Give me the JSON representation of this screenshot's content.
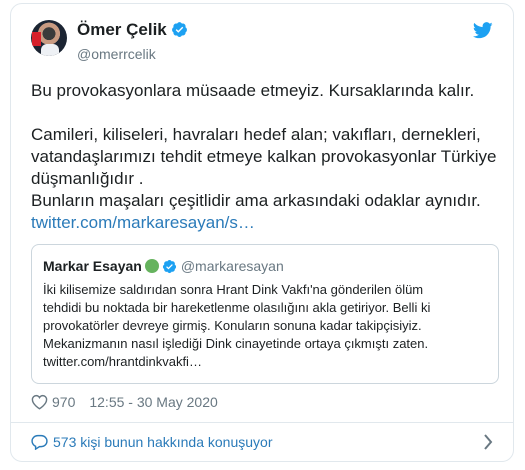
{
  "author": {
    "name": "Ömer Çelik",
    "handle": "@omerrcelik"
  },
  "tweet": {
    "lines": [
      "Bu provokasyonlara müsaade etmeyiz. Kursaklarında kalır.",
      "Camileri, kiliseleri, havraları hedef alan; vakıfları, dernekleri, vatandaşlarımızı tehdit etmeye kalkan provokasyonlar Türkiye düşmanlığıdır .",
      "Bunların maşaları çeşitlidir ama arkasındaki odaklar aynıdır."
    ],
    "link": "twitter.com/markaresayan/s…"
  },
  "quoted": {
    "name": "Markar Esayan",
    "handle": "@markaresayan",
    "body_lines": [
      "İki kilisemize saldırıdan sonra Hrant Dink Vakfı'na gönderilen ölüm",
      "tehdidi bu noktada bir hareketlenme olasılığını akla getiriyor. Belli ki",
      "provokatörler devreye girmiş. Konuların sonuna kadar takipçisiyiz.",
      "Mekanizmanın nasıl işlediği Dink cinayetinde ortaya çıkmıştı zaten.",
      "twitter.com/hrantdinkvakfi…"
    ]
  },
  "meta": {
    "likes": "970",
    "timestamp": "12:55 - 30 May 2020"
  },
  "conversation": {
    "label": "573 kişi bunun hakkında konuşuyor"
  },
  "colors": {
    "link": "#2b7bb9",
    "twitter_blue": "#1da1f2",
    "muted": "#697882",
    "border": "#e1e8ed"
  },
  "icons": {
    "verified": "verified-badge-icon",
    "brand": "twitter-bird-icon",
    "like": "heart-icon",
    "reply": "speech-bubble-icon",
    "more": "chevron-right-icon"
  }
}
